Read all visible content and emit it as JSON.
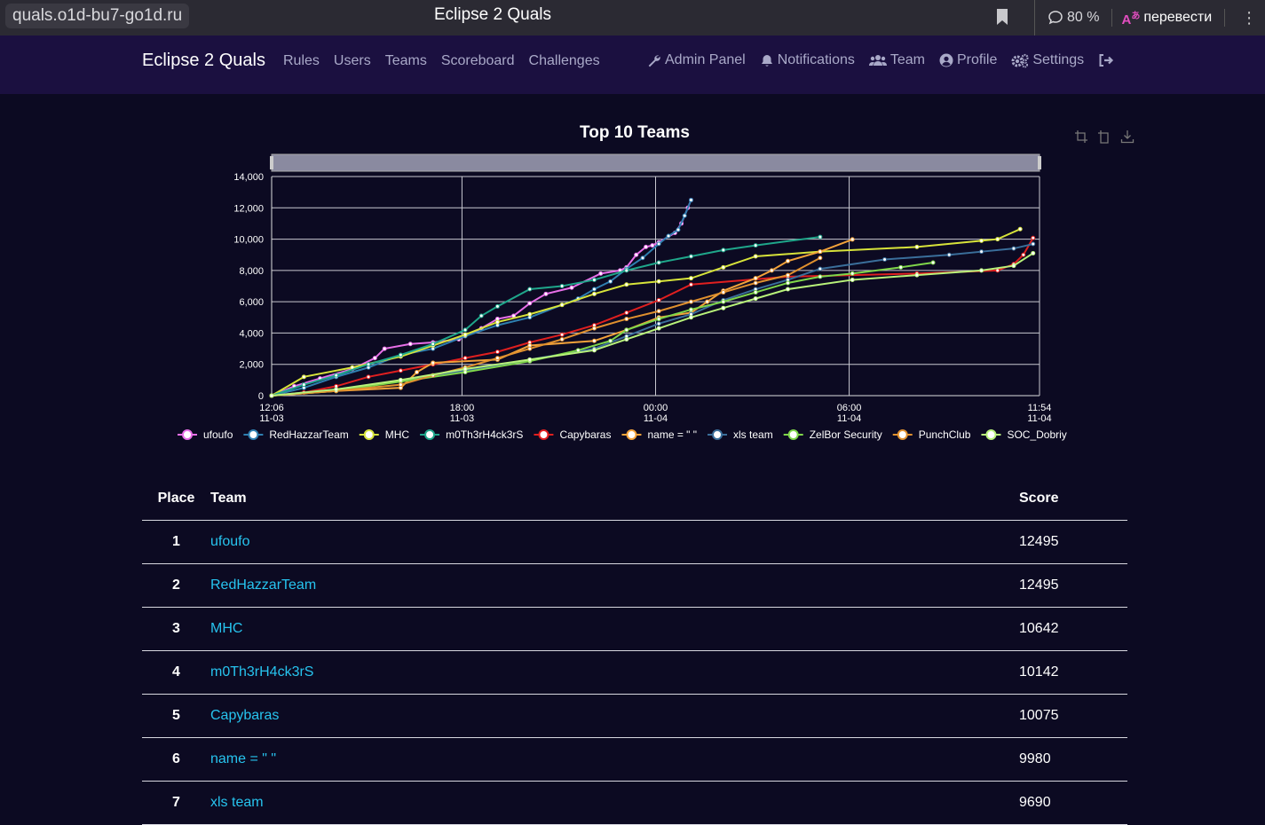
{
  "browser": {
    "url": "quals.o1d-bu7-go1d.ru",
    "tab_title": "Eclipse 2 Quals",
    "zoom": "80 %",
    "translate_label": "перевести"
  },
  "navbar": {
    "brand": "Eclipse 2 Quals",
    "left_links": [
      "Rules",
      "Users",
      "Teams",
      "Scoreboard",
      "Challenges"
    ],
    "right_links": [
      {
        "label": "Admin Panel",
        "icon": "wrench-icon"
      },
      {
        "label": "Notifications",
        "icon": "bell-icon"
      },
      {
        "label": "Team",
        "icon": "users-icon"
      },
      {
        "label": "Profile",
        "icon": "user-circle-icon"
      },
      {
        "label": "Settings",
        "icon": "gears-icon"
      }
    ],
    "logout_icon": "logout-icon"
  },
  "chart_data": {
    "type": "line",
    "title": "Top 10 Teams",
    "ylim": [
      0,
      14000
    ],
    "y_ticks": [
      "0",
      "2,000",
      "4,000",
      "6,000",
      "8,000",
      "10,000",
      "12,000",
      "14,000"
    ],
    "x_ticks": [
      {
        "time": "12:06",
        "date": "11-03"
      },
      {
        "time": "18:00",
        "date": "11-03"
      },
      {
        "time": "00:00",
        "date": "11-04"
      },
      {
        "time": "06:00",
        "date": "11-04"
      },
      {
        "time": "11:54",
        "date": "11-04"
      }
    ],
    "x_range_hours": [
      0,
      23.8
    ],
    "legend_position": "bottom",
    "grid": true,
    "series": [
      {
        "name": "ufoufo",
        "color": "#e86fe8",
        "x": [
          0,
          0.7,
          1.5,
          2.5,
          3.2,
          3.5,
          4.3,
          5.0,
          5.8,
          6.5,
          7.0,
          7.5,
          8.0,
          8.5,
          9.3,
          10.2,
          10.8,
          11.0,
          11.3,
          11.6,
          11.8,
          12.0,
          12.5,
          12.7,
          12.9,
          13.0
        ],
        "y": [
          0,
          600,
          1100,
          1700,
          2400,
          3000,
          3300,
          3400,
          3600,
          4300,
          4900,
          5100,
          5900,
          6500,
          6900,
          7800,
          8000,
          8200,
          9000,
          9500,
          9600,
          9800,
          10400,
          11000,
          12000,
          12495
        ]
      },
      {
        "name": "RedHazzarTeam",
        "color": "#2e7fb0",
        "x": [
          0,
          1.0,
          2.0,
          3.0,
          4.0,
          5.0,
          6.0,
          7.0,
          8.0,
          9.0,
          9.5,
          10.0,
          10.5,
          11.0,
          11.5,
          12.0,
          12.3,
          12.6,
          12.8,
          13.0
        ],
        "y": [
          0,
          500,
          1200,
          1800,
          2600,
          3000,
          3800,
          4500,
          5000,
          5800,
          6200,
          6800,
          7300,
          8100,
          8800,
          9700,
          10200,
          10600,
          11500,
          12495
        ]
      },
      {
        "name": "MHC",
        "color": "#d7e33a",
        "x": [
          0,
          1.0,
          2.5,
          4.0,
          5.0,
          6.0,
          7.0,
          8.0,
          9.0,
          10.0,
          11.0,
          12.0,
          13.0,
          14.0,
          15.0,
          17.0,
          20.0,
          22.0,
          22.5,
          23.2
        ],
        "y": [
          0,
          1200,
          1800,
          2500,
          3200,
          3900,
          4700,
          5200,
          5800,
          6500,
          7100,
          7300,
          7500,
          8200,
          8900,
          9200,
          9500,
          9900,
          10000,
          10642
        ]
      },
      {
        "name": "m0Th3rH4ck3rS",
        "color": "#1fa68a",
        "x": [
          0,
          1.0,
          2.0,
          3.0,
          4.0,
          5.0,
          6.0,
          6.5,
          7.0,
          8.0,
          9.0,
          10.0,
          11.0,
          12.0,
          13.0,
          14.0,
          15.0,
          17.0
        ],
        "y": [
          0,
          700,
          1300,
          2000,
          2600,
          3300,
          4200,
          5100,
          5700,
          6800,
          7000,
          7400,
          8000,
          8500,
          8900,
          9300,
          9600,
          10142
        ]
      },
      {
        "name": "Capybaras",
        "color": "#e01f1f",
        "x": [
          0,
          1.0,
          2.0,
          3.0,
          4.0,
          5.0,
          6.0,
          7.0,
          8.0,
          9.0,
          10.0,
          11.0,
          12.0,
          13.0,
          16.0,
          20.0,
          22.5,
          23.0,
          23.3,
          23.6
        ],
        "y": [
          0,
          200,
          600,
          1200,
          1600,
          2000,
          2400,
          2800,
          3400,
          3900,
          4500,
          5300,
          6100,
          7100,
          7600,
          7800,
          8000,
          8400,
          9000,
          10075
        ]
      },
      {
        "name": "name = \" \"",
        "color": "#f2a23a",
        "x": [
          0,
          2.0,
          4.0,
          4.5,
          5.0,
          7.0,
          8.0,
          10.0,
          11.0,
          12.0,
          13.0,
          13.5,
          14.0,
          15.0,
          15.5,
          16.0,
          17.0,
          18.0
        ],
        "y": [
          0,
          300,
          500,
          1500,
          2100,
          2300,
          3200,
          3500,
          4200,
          5000,
          5300,
          6000,
          6700,
          7500,
          8000,
          8600,
          9200,
          9980
        ]
      },
      {
        "name": "xls team",
        "color": "#3a6e9a",
        "x": [
          0,
          2.0,
          4.0,
          6.0,
          8.0,
          10.0,
          11.0,
          12.0,
          13.0,
          14.0,
          15.0,
          16.0,
          17.0,
          19.0,
          21.0,
          22.0,
          23.0,
          23.6
        ],
        "y": [
          0,
          400,
          900,
          1600,
          2300,
          3000,
          3800,
          4600,
          5200,
          6100,
          6800,
          7400,
          8100,
          8700,
          9000,
          9200,
          9400,
          9690
        ]
      },
      {
        "name": "ZelBor Security",
        "color": "#7fd64a",
        "x": [
          0,
          2.0,
          4.0,
          6.0,
          8.0,
          9.5,
          10.5,
          11.0,
          12.0,
          13.0,
          14.0,
          15.0,
          16.0,
          17.0,
          18.0,
          19.5,
          20.5
        ],
        "y": [
          0,
          300,
          900,
          1500,
          2200,
          2900,
          3500,
          4200,
          4900,
          5500,
          6000,
          6600,
          7200,
          7600,
          7800,
          8200,
          8500
        ]
      },
      {
        "name": "PunchClub",
        "color": "#e0902e",
        "x": [
          0,
          2.0,
          4.0,
          5.0,
          6.0,
          7.0,
          8.0,
          9.0,
          10.0,
          11.0,
          12.0,
          13.0,
          14.0,
          15.0,
          16.0,
          17.0
        ],
        "y": [
          0,
          300,
          700,
          1300,
          1800,
          2400,
          3000,
          3600,
          4300,
          4900,
          5400,
          6000,
          6600,
          7200,
          7700,
          8800
        ]
      },
      {
        "name": "SOC_Dobriy",
        "color": "#b8f27a",
        "x": [
          0,
          2.0,
          4.0,
          6.0,
          8.0,
          10.0,
          11.0,
          12.0,
          13.0,
          14.0,
          15.0,
          16.0,
          18.0,
          20.0,
          22.0,
          23.0,
          23.6
        ],
        "y": [
          0,
          400,
          1000,
          1700,
          2300,
          2900,
          3600,
          4300,
          5000,
          5600,
          6200,
          6800,
          7400,
          7700,
          8000,
          8300,
          9100
        ]
      }
    ]
  },
  "toolbox_icons": [
    "zoom-icon",
    "zoom-reset-icon",
    "download-icon"
  ],
  "table": {
    "headers": {
      "place": "Place",
      "team": "Team",
      "score": "Score"
    },
    "rows": [
      {
        "place": "1",
        "team": "ufoufo",
        "score": "12495"
      },
      {
        "place": "2",
        "team": "RedHazzarTeam",
        "score": "12495"
      },
      {
        "place": "3",
        "team": "MHC",
        "score": "10642"
      },
      {
        "place": "4",
        "team": "m0Th3rH4ck3rS",
        "score": "10142"
      },
      {
        "place": "5",
        "team": "Capybaras",
        "score": "10075"
      },
      {
        "place": "6",
        "team": "name = \" \"",
        "score": "9980"
      },
      {
        "place": "7",
        "team": "xls team",
        "score": "9690"
      }
    ]
  }
}
